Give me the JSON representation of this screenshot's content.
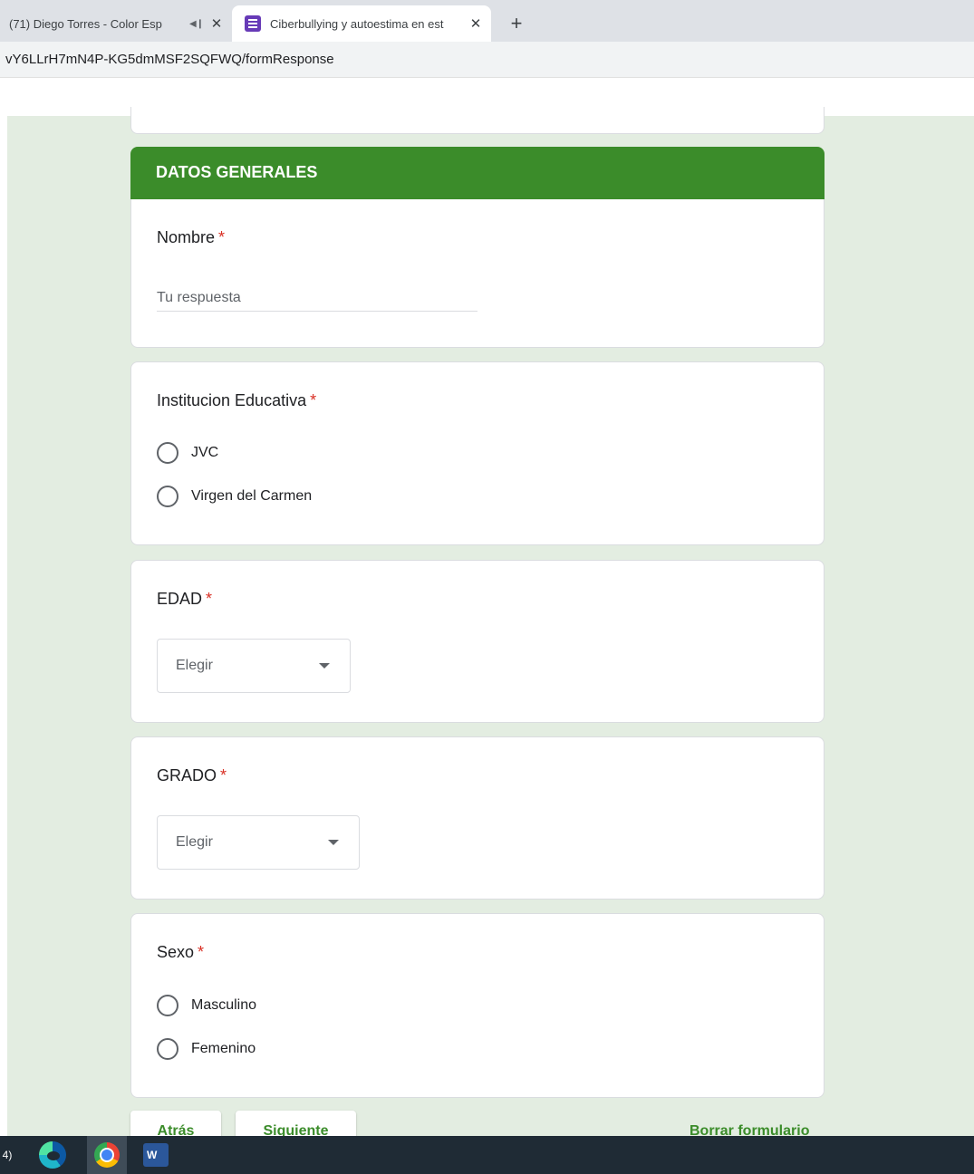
{
  "browser": {
    "tabs": [
      {
        "label": "(71) Diego Torres - Color Esp",
        "active": false,
        "audio": true
      },
      {
        "label": "Ciberbullying y autoestima en est",
        "active": true,
        "audio": false
      }
    ],
    "new_tab_label": "+",
    "close_glyph": "✕",
    "url": "vY6LLrH7mN4P-KG5dmMSF2SQFWQ/formResponse"
  },
  "form": {
    "section_title": "DATOS GENERALES",
    "required_mark": "*",
    "questions": {
      "nombre": {
        "label": "Nombre",
        "placeholder": "Tu respuesta"
      },
      "institucion": {
        "label": "Institucion Educativa",
        "options": [
          "JVC",
          "Virgen del Carmen"
        ]
      },
      "edad": {
        "label": "EDAD",
        "selected": "Elegir"
      },
      "grado": {
        "label": "GRADO",
        "selected": "Elegir"
      },
      "sexo": {
        "label": "Sexo",
        "options": [
          "Masculino",
          "Femenino"
        ]
      }
    },
    "buttons": {
      "back": "Atrás",
      "next": "Siguiente",
      "clear": "Borrar formulario"
    }
  },
  "taskbar": {
    "number_label": "4)",
    "word_label": "W"
  },
  "colors": {
    "accent": "#3b8c2a",
    "background": "#e3ede1",
    "required": "#d93025"
  }
}
